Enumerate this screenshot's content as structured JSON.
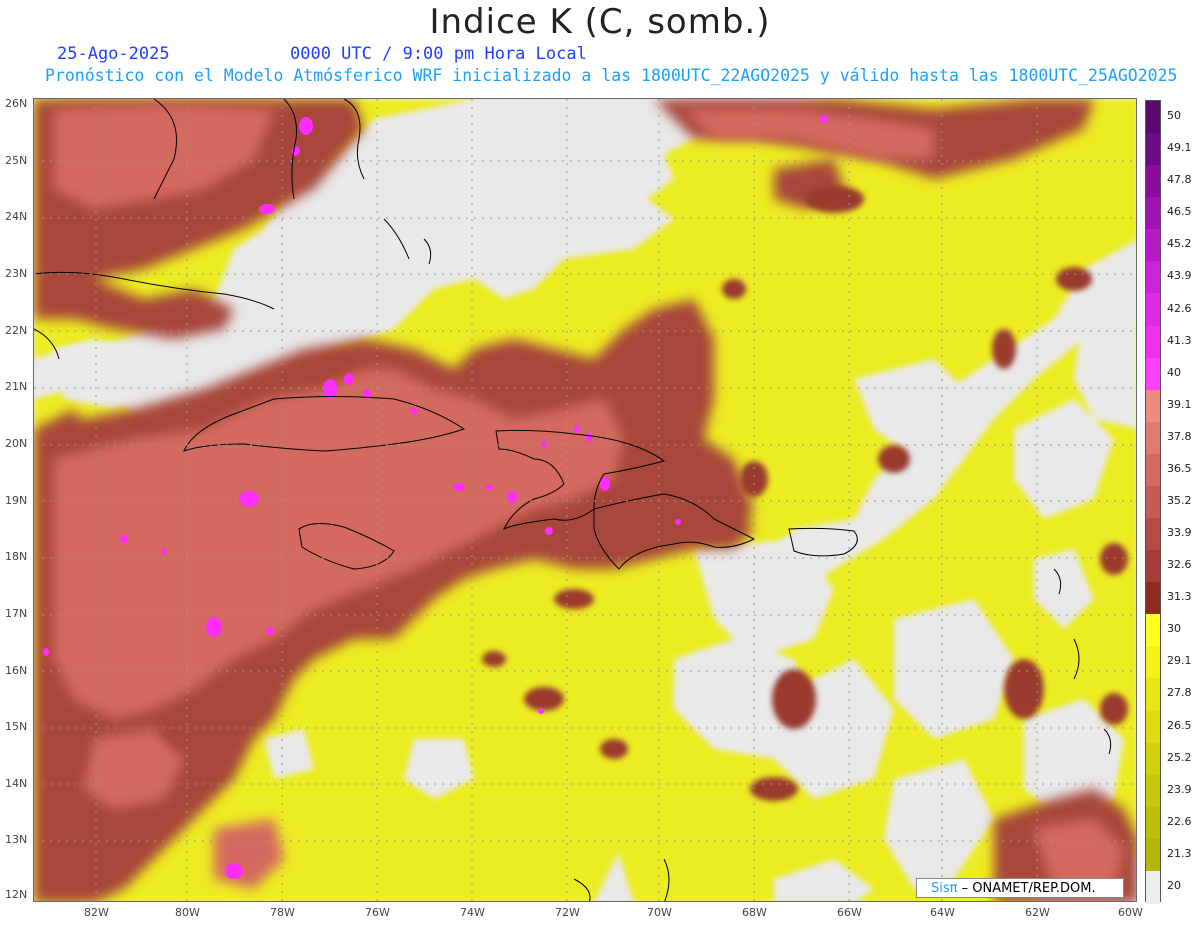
{
  "header": {
    "title": "Indice K (C, somb.)",
    "date": "25-Ago-2025",
    "time": "0000 UTC / 9:00 pm Hora Local",
    "subtitle": "Pronóstico con el Modelo Atmósferico WRF inicializado a las 1800UTC_22AGO2025 y válido hasta las  1800UTC_25AGO2025"
  },
  "axes": {
    "lat_labels": [
      "26N",
      "25N",
      "24N",
      "23N",
      "22N",
      "21N",
      "20N",
      "19N",
      "18N",
      "17N",
      "16N",
      "15N",
      "14N",
      "13N",
      "12N"
    ],
    "lon_labels": [
      "82W",
      "80W",
      "78W",
      "76W",
      "74W",
      "72W",
      "70W",
      "68W",
      "66W",
      "64W",
      "62W",
      "60W"
    ]
  },
  "colorbar": {
    "labels": [
      "50",
      "49.1",
      "47.8",
      "46.5",
      "45.2",
      "43.9",
      "42.6",
      "41.3",
      "40",
      "39.1",
      "37.8",
      "36.5",
      "35.2",
      "33.9",
      "32.6",
      "31.3",
      "30",
      "29.1",
      "27.8",
      "26.5",
      "25.2",
      "23.9",
      "22.6",
      "21.3",
      "20"
    ],
    "colors": [
      "#5a0a6e",
      "#6e0a86",
      "#8a0c9e",
      "#a012b4",
      "#b81ac8",
      "#cc22da",
      "#de2ae6",
      "#ee30f0",
      "#ff40ff",
      "#f08a80",
      "#e07a70",
      "#d46a62",
      "#c65a54",
      "#b84a46",
      "#a83c38",
      "#8e2a20",
      "#ffff22",
      "#f2f218",
      "#e6e612",
      "#dcdc10",
      "#d2d20c",
      "#c8c80a",
      "#bebe08",
      "#b4b406",
      "#eeeeee"
    ]
  },
  "credit": {
    "brand": "Sisπ",
    "org": " – ONAMET/REP.DOM."
  },
  "colors": {
    "dry": "#e9e9e9",
    "moderate": "#eaea1e",
    "high": "#b04a3c",
    "extreme": "#ff30ff",
    "coast": "#000000"
  }
}
